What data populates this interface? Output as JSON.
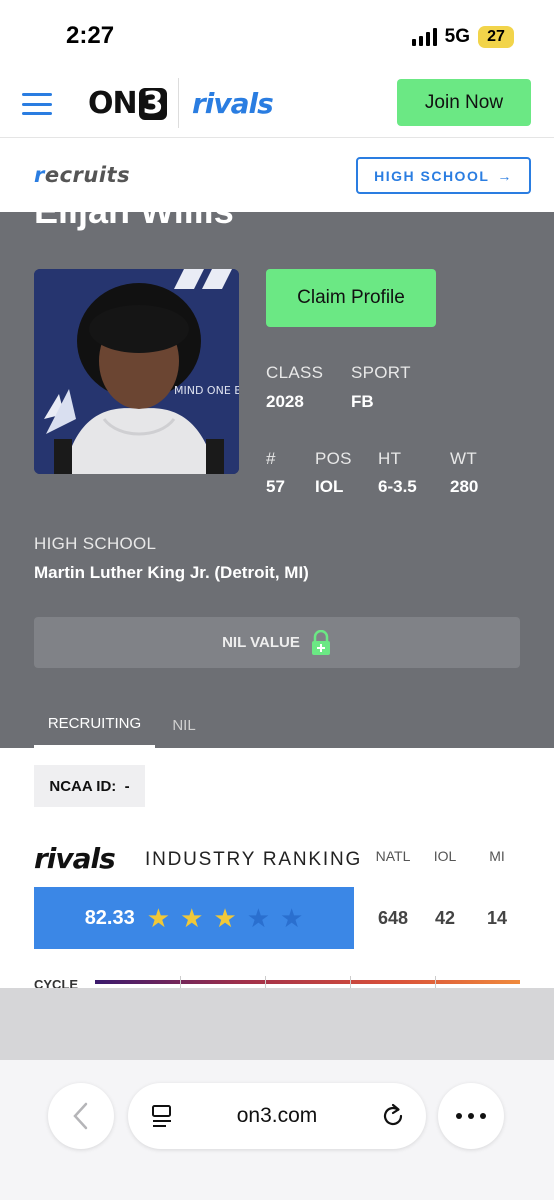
{
  "status_bar": {
    "time": "2:27",
    "network": "5G",
    "battery": "27"
  },
  "header": {
    "brand_on3": "ON",
    "brand_on3_digit": "3",
    "brand_rivals": "rivals",
    "join_label": "Join Now"
  },
  "subnav": {
    "recruits_r": "r",
    "recruits_rest": "ecruits",
    "high_school_label": "HIGH SCHOOL",
    "arrow": "→"
  },
  "profile": {
    "name": "Elijah Willis",
    "claim_label": "Claim Profile",
    "class_label": "CLASS",
    "class_value": "2028",
    "sport_label": "SPORT",
    "sport_value": "FB",
    "number_label": "#",
    "number_value": "57",
    "pos_label": "POS",
    "pos_value": "IOL",
    "ht_label": "HT",
    "ht_value": "6-3.5",
    "wt_label": "WT",
    "wt_value": "280",
    "hs_label": "HIGH SCHOOL",
    "hs_value": "Martin Luther King Jr. (Detroit, MI)",
    "nil_label": "NIL VALUE",
    "tabs": [
      {
        "label": "RECRUITING"
      },
      {
        "label": "NIL"
      }
    ],
    "photo_shirt_text": "MIND ONE BODY"
  },
  "ranking": {
    "ncaa_label": "NCAA ID:",
    "ncaa_value": "-",
    "brand": "rivals",
    "title": "INDUSTRY RANKING",
    "columns": [
      "NATL",
      "IOL",
      "MI"
    ],
    "values": [
      "648",
      "42",
      "14"
    ],
    "score": "82.33",
    "stars_filled": 3,
    "stars_total": 5,
    "cycle_label": "CYCLE",
    "colors": {
      "score_bg": "#3b87e6",
      "star_on": "#f0c838"
    }
  },
  "browser": {
    "url": "on3.com"
  }
}
